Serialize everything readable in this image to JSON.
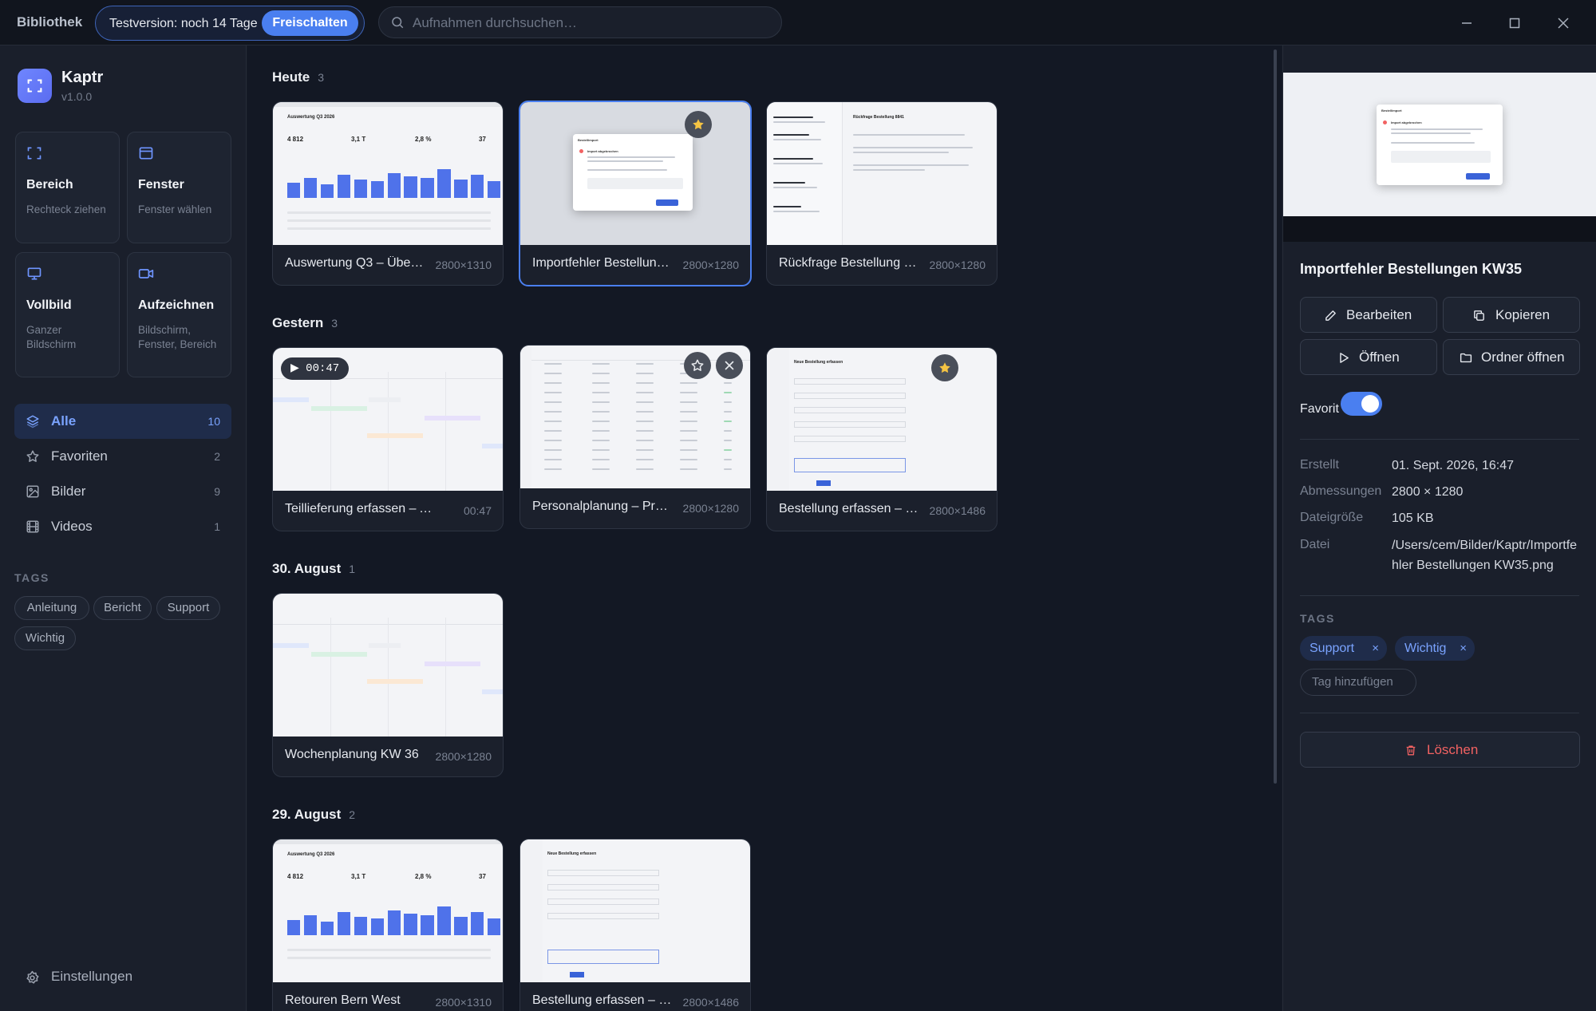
{
  "titlebar": {
    "title": "Bibliothek",
    "trial_text": "Testversion: noch 14 Tage",
    "unlock_label": "Freischalten",
    "search_placeholder": "Aufnahmen durchsuchen…"
  },
  "sidebar": {
    "app_name": "Kaptr",
    "version": "v1.0.0",
    "capture_modes": [
      {
        "title": "Bereich",
        "sub": "Rechteck ziehen",
        "icon": "area-icon"
      },
      {
        "title": "Fenster",
        "sub": "Fenster wählen",
        "icon": "window-icon"
      },
      {
        "title": "Vollbild",
        "sub": "Ganzer Bildschirm",
        "icon": "monitor-icon"
      },
      {
        "title": "Aufzeichnen",
        "sub": "Bildschirm, Fenster, Bereich",
        "icon": "video-icon"
      }
    ],
    "nav": [
      {
        "label": "Alle",
        "count": "10",
        "icon": "layers-icon",
        "active": true
      },
      {
        "label": "Favoriten",
        "count": "2",
        "icon": "star-icon"
      },
      {
        "label": "Bilder",
        "count": "9",
        "icon": "image-icon"
      },
      {
        "label": "Videos",
        "count": "1",
        "icon": "film-icon"
      }
    ],
    "tags_heading": "TAGS",
    "tags": [
      "Anleitung",
      "Bericht",
      "Support",
      "Wichtig"
    ],
    "settings_label": "Einstellungen"
  },
  "groups": [
    {
      "title": "Heute",
      "count": "3"
    },
    {
      "title": "Gestern",
      "count": "3"
    },
    {
      "title": "30. August",
      "count": "1"
    },
    {
      "title": "29. August",
      "count": "2"
    }
  ],
  "cards": [
    {
      "name": "Auswertung Q3 – Übe…",
      "dim": "2800×1310"
    },
    {
      "name": "Importfehler Bestellun…",
      "dim": "2800×1280"
    },
    {
      "name": "Rückfrage Bestellung …",
      "dim": "2800×1280"
    },
    {
      "name": "Teillieferung erfassen – Abl…",
      "dim": "00:47",
      "duration": "▶ 00:47"
    },
    {
      "name": "Personalplanung – Pr…",
      "dim": "2800×1280"
    },
    {
      "name": "Bestellung erfassen – …",
      "dim": "2800×1486"
    },
    {
      "name": "Wochenplanung KW 36",
      "dim": "2800×1280"
    },
    {
      "name": "Retouren Bern West",
      "dim": "2800×1310"
    },
    {
      "name": "Bestellung erfassen – …",
      "dim": "2800×1486"
    }
  ],
  "thumb_text": {
    "report_title": "Auswertung Q3 2026",
    "stats": [
      "4 812",
      "3,1 T",
      "2,8 %",
      "37"
    ],
    "dialog_title": "Bestellimport",
    "dialog_heading": "Import abgebrochen",
    "msg_title": "Rückfrage Bestellung 8841",
    "form_title": "Neue Bestellung erfassen"
  },
  "detail": {
    "title": "Importfehler Bestellungen KW35",
    "buttons": [
      "Bearbeiten",
      "Kopieren",
      "Öffnen",
      "Ordner öffnen"
    ],
    "favorite_label": "Favorit",
    "meta": [
      {
        "k": "Erstellt",
        "v": "01. Sept. 2026, 16:47"
      },
      {
        "k": "Abmessungen",
        "v": "2800 × 1280"
      },
      {
        "k": "Dateigröße",
        "v": "105 KB"
      },
      {
        "k": "Datei",
        "v": "/Users/cem/Bilder/Kaptr/Importfehler Bestellungen KW35.png"
      }
    ],
    "tags_heading": "TAGS",
    "tags": [
      "Support",
      "Wichtig"
    ],
    "tag_remove": "×",
    "add_tag": "Tag hinzufügen",
    "delete_label": "Löschen"
  },
  "colors": {
    "accent": "#4a7ff0",
    "background": "#131824",
    "danger": "#f26262",
    "favorite": "#f5c443"
  }
}
